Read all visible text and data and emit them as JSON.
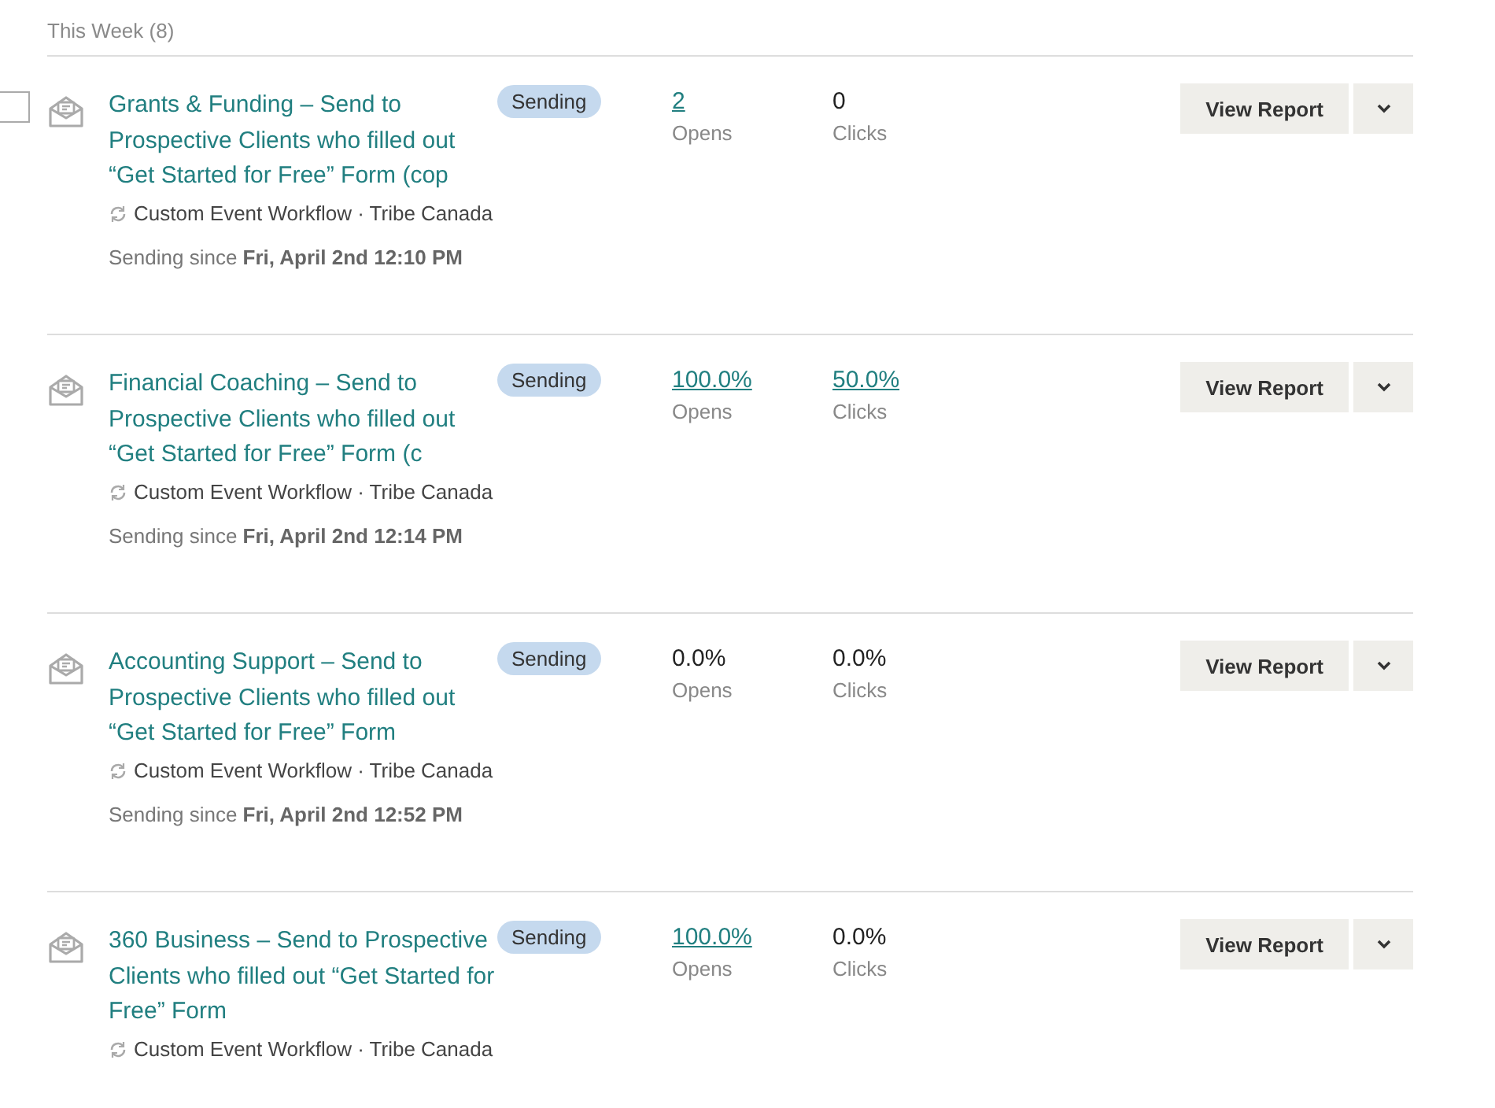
{
  "section_header": "This Week (8)",
  "campaigns": [
    {
      "checkbox": {
        "checked": false
      },
      "title": "Grants & Funding – Send to Prospective Clients who filled out “Get Started for Free” Form (cop",
      "workflow": "Custom Event Workflow · Tribe Canada",
      "sending_since_label": "Sending since",
      "sending_since_date": "Fri, April 2nd 12:10 PM",
      "status": "Sending",
      "opens": {
        "value": "2",
        "label": "Opens",
        "linked": true
      },
      "clicks": {
        "value": "0",
        "label": "Clicks",
        "linked": false
      },
      "button": "View Report"
    },
    {
      "title": "Financial Coaching – Send to Prospective Clients who filled out “Get Started for Free” Form (c",
      "workflow": "Custom Event Workflow · Tribe Canada",
      "sending_since_label": "Sending since",
      "sending_since_date": "Fri, April 2nd 12:14 PM",
      "status": "Sending",
      "opens": {
        "value": "100.0%",
        "label": "Opens",
        "linked": true
      },
      "clicks": {
        "value": "50.0%",
        "label": "Clicks",
        "linked": true
      },
      "button": "View Report"
    },
    {
      "title": "Accounting Support – Send to Prospective Clients who filled out “Get Started for Free” Form",
      "workflow": "Custom Event Workflow · Tribe Canada",
      "sending_since_label": "Sending since",
      "sending_since_date": "Fri, April 2nd 12:52 PM",
      "status": "Sending",
      "opens": {
        "value": "0.0%",
        "label": "Opens",
        "linked": false
      },
      "clicks": {
        "value": "0.0%",
        "label": "Clicks",
        "linked": false
      },
      "button": "View Report"
    },
    {
      "title": "360 Business – Send to Prospective Clients who filled out “Get Started for Free” Form",
      "workflow": "Custom Event Workflow · Tribe Canada",
      "status": "Sending",
      "opens": {
        "value": "100.0%",
        "label": "Opens",
        "linked": true
      },
      "clicks": {
        "value": "0.0%",
        "label": "Clicks",
        "linked": false
      },
      "button": "View Report"
    }
  ]
}
